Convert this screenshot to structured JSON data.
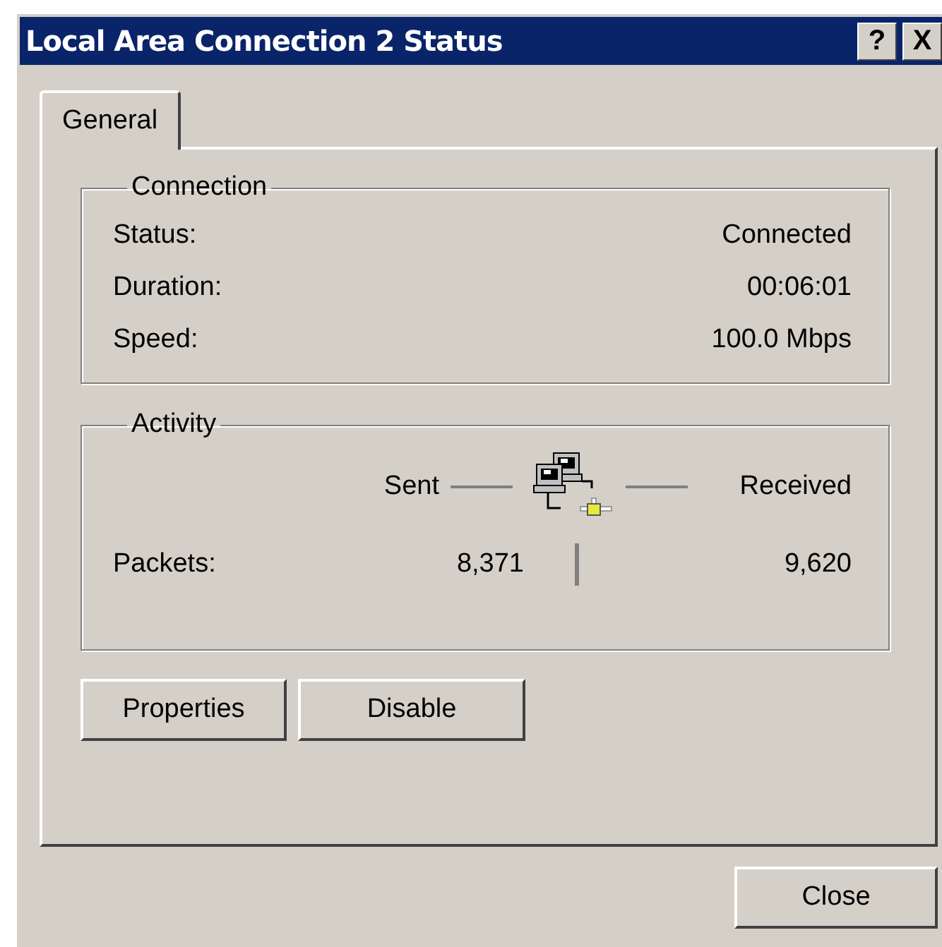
{
  "window": {
    "title": "Local Area Connection 2 Status",
    "title_buttons": [
      "?",
      "X"
    ]
  },
  "tabs": [
    {
      "label": "General",
      "selected": true
    }
  ],
  "connection": {
    "title": "Connection",
    "rows": [
      {
        "label": "Status:",
        "value": "Connected"
      },
      {
        "label": "Duration:",
        "value": "00:06:01"
      },
      {
        "label": "Speed:",
        "value": "100.0 Mbps"
      }
    ]
  },
  "activity": {
    "title": "Activity",
    "sent_label": "Sent",
    "received_label": "Received",
    "packets_label": "Packets:",
    "sent": "8,371",
    "received": "9,620"
  },
  "buttons": [
    "Properties",
    "Disable"
  ],
  "close_button": "Close"
}
